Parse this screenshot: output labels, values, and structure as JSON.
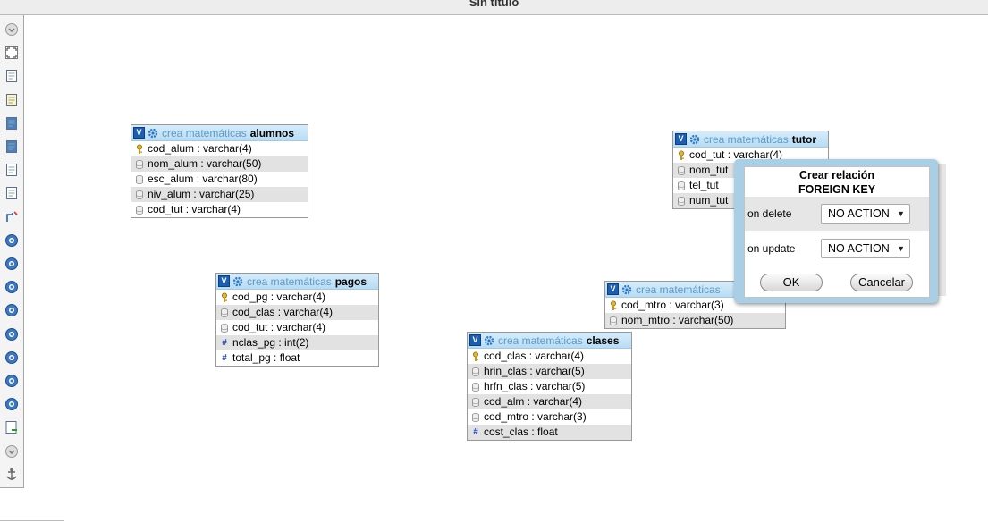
{
  "window": {
    "title": "Sin título"
  },
  "toolbar": {
    "icons": [
      "show-hide-left-menu-icon",
      "fullscreen-icon",
      "new-page-icon",
      "edit-page-icon",
      "save-icon",
      "save-as-icon",
      "delete-page-icon",
      "open-page-icon",
      "create-relation-icon",
      "toggle-relation-lines-icon",
      "reload-icon",
      "help-icon",
      "angular-links-icon",
      "snap-to-grid-icon",
      "small-big-all-icon",
      "toggle-small-big-icon",
      "toggle-column-icon",
      "export-schema-icon",
      "move-menu-icon",
      "pin-text-icon"
    ]
  },
  "tables": {
    "alumnos": {
      "db": "crea matemáticas",
      "name": "alumnos",
      "columns": [
        {
          "text": "cod_alum : varchar(4)",
          "icon": "primary-key-icon"
        },
        {
          "text": "nom_alum : varchar(50)",
          "icon": "column-icon"
        },
        {
          "text": "esc_alum : varchar(80)",
          "icon": "column-icon"
        },
        {
          "text": "niv_alum : varchar(25)",
          "icon": "column-icon"
        },
        {
          "text": "cod_tut : varchar(4)",
          "icon": "column-icon"
        }
      ]
    },
    "pagos": {
      "db": "crea matemáticas",
      "name": "pagos",
      "columns": [
        {
          "text": "cod_pg : varchar(4)",
          "icon": "primary-key-icon"
        },
        {
          "text": "cod_clas : varchar(4)",
          "icon": "column-icon"
        },
        {
          "text": "cod_tut : varchar(4)",
          "icon": "column-icon"
        },
        {
          "text": "nclas_pg : int(2)",
          "icon": "numeric-icon"
        },
        {
          "text": "total_pg : float",
          "icon": "numeric-icon"
        }
      ]
    },
    "clases": {
      "db": "crea matemáticas",
      "name": "clases",
      "columns": [
        {
          "text": "cod_clas : varchar(4)",
          "icon": "primary-key-icon"
        },
        {
          "text": "hrin_clas : varchar(5)",
          "icon": "column-icon"
        },
        {
          "text": "hrfn_clas : varchar(5)",
          "icon": "column-icon"
        },
        {
          "text": "cod_alm : varchar(4)",
          "icon": "column-icon"
        },
        {
          "text": "cod_mtro : varchar(3)",
          "icon": "column-icon"
        },
        {
          "text": "cost_clas : float",
          "icon": "numeric-icon"
        }
      ]
    },
    "tutor": {
      "db": "crea matemáticas",
      "name": "tutor",
      "columns": [
        {
          "text": "cod_tut : varchar(4)",
          "icon": "primary-key-icon"
        },
        {
          "text": "nom_tut",
          "icon": "column-icon"
        },
        {
          "text": "tel_tut",
          "icon": "column-icon"
        },
        {
          "text": "num_tut",
          "icon": "column-icon"
        }
      ]
    },
    "maestros": {
      "db": "crea matemáticas",
      "name": "",
      "columns": [
        {
          "text": "cod_mtro : varchar(3)",
          "icon": "primary-key-icon"
        },
        {
          "text": "nom_mtro : varchar(50)",
          "icon": "column-icon"
        }
      ]
    }
  },
  "dialog": {
    "title_line1": "Crear relación",
    "title_line2": "FOREIGN KEY",
    "on_delete_label": "on delete",
    "on_delete_value": "NO ACTION",
    "on_update_label": "on update",
    "on_update_value": "NO ACTION",
    "ok_label": "OK",
    "cancel_label": "Cancelar"
  },
  "colors": {
    "table_header": "#b8dcf4",
    "db_name": "#5d9bc5",
    "dialog_frame": "#a9cfe7",
    "toolbar_icon": "#3b78c2"
  }
}
